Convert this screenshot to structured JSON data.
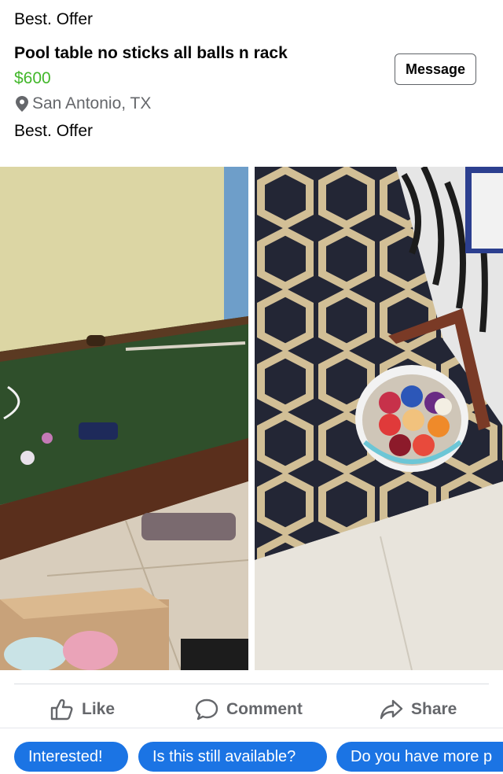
{
  "header": {
    "top_text": "Best. Offer"
  },
  "listing": {
    "title": "Pool table no sticks all balls n rack",
    "price": "$600",
    "location": "San Antonio, TX",
    "note": "Best. Offer",
    "message_button": "Message"
  },
  "actions": {
    "like": "Like",
    "comment": "Comment",
    "share": "Share"
  },
  "quick_replies": [
    "Interested!",
    "Is this still available?",
    "Do you have more p"
  ],
  "colors": {
    "price": "#42b72a",
    "chip": "#1b74e4",
    "muted": "#65676b"
  }
}
